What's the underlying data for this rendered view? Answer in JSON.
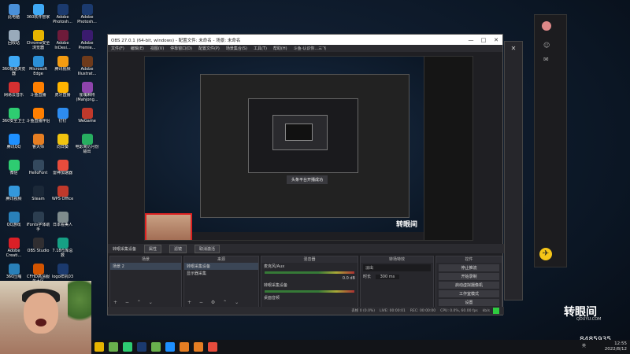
{
  "desktop": {
    "icons": [
      {
        "label": "此电脑",
        "icon": "computer-icon",
        "color": "#4a90d9"
      },
      {
        "label": "360软件管家",
        "icon": "360-manager-icon",
        "color": "#3fa9f5"
      },
      {
        "label": "Adobe Photosh...",
        "icon": "photoshop-icon",
        "color": "#1b3a6e"
      },
      {
        "label": "Adobe Photosh...",
        "icon": "photoshop-icon",
        "color": "#1b3a6e"
      },
      {
        "label": "回收站",
        "icon": "recycle-bin-icon",
        "color": "#9ab"
      },
      {
        "label": "Chrome安全浏览器",
        "icon": "chrome-icon",
        "color": "#e8b400"
      },
      {
        "label": "Adobe InDesi...",
        "icon": "indesign-icon",
        "color": "#6e1b3a"
      },
      {
        "label": "Adobe Premie...",
        "icon": "premiere-icon",
        "color": "#3a1b6e"
      },
      {
        "label": "360极速浏览器",
        "icon": "360-browser-icon",
        "color": "#3fa9f5"
      },
      {
        "label": "Microsoft Edge",
        "icon": "edge-icon",
        "color": "#2b8fd6"
      },
      {
        "label": "腾讯视频",
        "icon": "video-icon",
        "color": "#f39c12"
      },
      {
        "label": "Adobe Illustrat...",
        "icon": "illustrator-icon",
        "color": "#6e3a1b"
      },
      {
        "label": "网易云音乐",
        "icon": "music-icon",
        "color": "#d63031"
      },
      {
        "label": "斗鱼直播",
        "icon": "douyu-icon",
        "color": "#ff7f00"
      },
      {
        "label": "虎牙直播",
        "icon": "huya-icon",
        "color": "#ffb400"
      },
      {
        "label": "雀魂麻将 (Mahjong...",
        "icon": "mahjong-icon",
        "color": "#8e44ad"
      },
      {
        "label": "360安全卫士",
        "icon": "360-safe-icon",
        "color": "#2ecc71"
      },
      {
        "label": "斗鱼直播伴侣",
        "icon": "douyu-companion-icon",
        "color": "#ff7f00"
      },
      {
        "label": "钉钉",
        "icon": "dingtalk-icon",
        "color": "#2d8cf0"
      },
      {
        "label": "WeGame",
        "icon": "wegame-icon",
        "color": "#c0392b"
      },
      {
        "label": "腾讯QQ",
        "icon": "qq-icon",
        "color": "#1e90ff"
      },
      {
        "label": "鲁大师",
        "icon": "ludashi-icon",
        "color": "#e67e22"
      },
      {
        "label": "向日葵",
        "icon": "sunflower-icon",
        "color": "#f1c40f"
      },
      {
        "label": "电影简历月份输出",
        "icon": "document-icon",
        "color": "#27ae60"
      },
      {
        "label": "微信",
        "icon": "wechat-icon",
        "color": "#2ecc71"
      },
      {
        "label": "HelloFont",
        "icon": "hellofont-icon",
        "color": "#34495e"
      },
      {
        "label": "雷神加速器",
        "icon": "accelerator-icon",
        "color": "#e74c3c"
      },
      {
        "label": "",
        "icon": "",
        "color": "transparent"
      },
      {
        "label": "腾讯视频",
        "icon": "tencent-video-icon",
        "color": "#3498db"
      },
      {
        "label": "Steam",
        "icon": "steam-icon",
        "color": "#1b2838"
      },
      {
        "label": "WPS Office",
        "icon": "wps-icon",
        "color": "#c0392b"
      },
      {
        "label": "",
        "icon": "",
        "color": "transparent"
      },
      {
        "label": "QQ游戏",
        "icon": "qq-game-icon",
        "color": "#2980b9"
      },
      {
        "label": "iFonts字体助手",
        "icon": "ifonts-icon",
        "color": "#2c3e50"
      },
      {
        "label": "日本看美人",
        "icon": "document-icon",
        "color": "#7f8c8d"
      },
      {
        "label": "",
        "icon": "",
        "color": "transparent"
      },
      {
        "label": "Adobe Creati...",
        "icon": "creative-cloud-icon",
        "color": "#da1f26"
      },
      {
        "label": "OBS Studio",
        "icon": "obs-icon",
        "color": "#302e31"
      },
      {
        "label": "7.18仓库总数",
        "icon": "document-icon",
        "color": "#16a085"
      },
      {
        "label": "",
        "icon": "",
        "color": "transparent"
      },
      {
        "label": "360压缩",
        "icon": "360-zip-icon",
        "color": "#2980b9"
      },
      {
        "label": "CFHD高清服务大区",
        "icon": "cfhd-icon",
        "color": "#d35400"
      },
      {
        "label": "logo样机03",
        "icon": "photoshop-icon",
        "color": "#1b3a6e"
      },
      {
        "label": "",
        "icon": "",
        "color": "transparent"
      }
    ]
  },
  "obs": {
    "title": "OBS 27.0.1 (64-bit, windows) - 配置文件: 未命名 - 场景: 未命名",
    "controls": [
      "—",
      "□",
      "✕"
    ],
    "menu": [
      "文件(F)",
      "编辑(E)",
      "视图(V)",
      "停靠窗口(D)",
      "配置文件(P)",
      "场景集合(S)",
      "工具(T)",
      "帮助(H)",
      "斗鱼-认识你...三飞"
    ],
    "preview_toast": "头条平台开播成功",
    "preview_logo": "转眼间",
    "scene_bar": {
      "label": "转眼采集设备",
      "properties": "属性",
      "filters": "滤镜",
      "deactivate": "取消激活"
    },
    "scenes": {
      "header": "场景",
      "items": [
        "场景 2"
      ]
    },
    "sources": {
      "header": "来源",
      "items": [
        "转眼采集设备",
        "显示器采集"
      ]
    },
    "mixer": {
      "header": "混音器",
      "channels": [
        {
          "name": "麦克风/Aux",
          "db": "0.0 dB"
        },
        {
          "name": "转眼采集设备",
          "db": "0.0 dB"
        },
        {
          "name": "桌面音频",
          "db": "0.0 dB"
        }
      ]
    },
    "transitions": {
      "header": "转场特效",
      "type": "淡出",
      "duration_label": "时长",
      "duration": "300 ms"
    },
    "controls_dock": {
      "header": "控件",
      "buttons": [
        "停止推流",
        "开始录制",
        "启动虚拟摄像机",
        "工作室模式",
        "设置",
        "退出"
      ]
    },
    "status": {
      "dropped": "丢帧 0 (0.0%)",
      "live": "LIVE: 00:00:01",
      "rec": "REC: 00:00:00",
      "cpu": "CPU: 0.0%, 60.00 fps",
      "kbps": "kb/s"
    },
    "status_color": "#2ecc40"
  },
  "watermark": {
    "brand": "转眼间",
    "sub": "QDUYU.COM",
    "room": "8485935"
  },
  "taskbar": {
    "apps": [
      {
        "icon": "chrome-icon",
        "color": "#e8b400"
      },
      {
        "icon": "chat-icon",
        "color": "#6ab04c"
      },
      {
        "icon": "wechat-icon",
        "color": "#2ecc71"
      },
      {
        "icon": "photoshop-icon",
        "color": "#1b3a6e"
      },
      {
        "icon": "accelerator-icon",
        "color": "#6ab04c"
      },
      {
        "icon": "wechat-icon",
        "color": "#1e90ff"
      },
      {
        "icon": "obs-icon",
        "color": "#e67e22"
      },
      {
        "icon": "douyu-icon",
        "color": "#e67e22"
      },
      {
        "icon": "search-icon",
        "color": "#e74c3c"
      }
    ],
    "tray": "英",
    "time": "12:55",
    "date": "2022/8/12"
  }
}
